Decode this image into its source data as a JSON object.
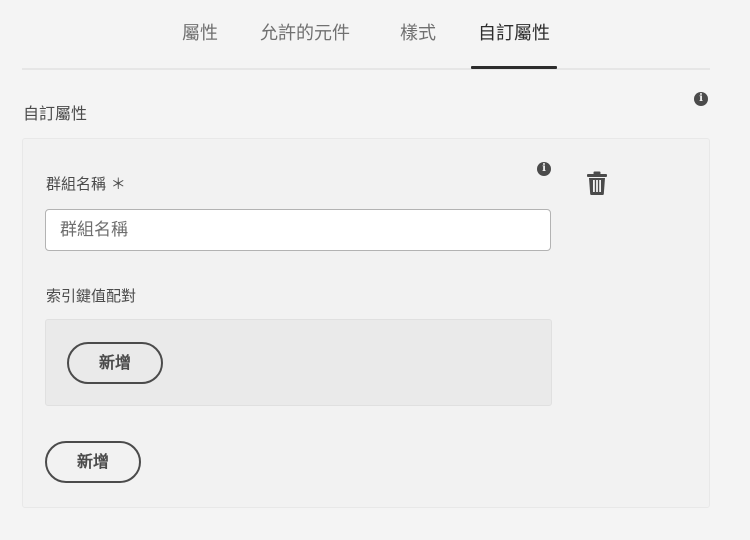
{
  "tabs": [
    {
      "label": "屬性",
      "active": false
    },
    {
      "label": "允許的元件",
      "active": false
    },
    {
      "label": "樣式",
      "active": false
    },
    {
      "label": "自訂屬性",
      "active": true
    }
  ],
  "section": {
    "title": "自訂屬性",
    "info_icon": "info-icon"
  },
  "group": {
    "name_label": "群組名稱 ＊",
    "name_placeholder": "群組名稱",
    "name_value": "",
    "info_icon": "info-icon",
    "delete_icon": "trash-icon",
    "kv_label": "索引鍵值配對",
    "kv_add_label": "新增"
  },
  "add_group_label": "新增",
  "colors": {
    "background": "#f4f4f4",
    "panel": "#f2f2f2",
    "text": "#4b4b4b",
    "active_tab": "#2c2c2c"
  }
}
